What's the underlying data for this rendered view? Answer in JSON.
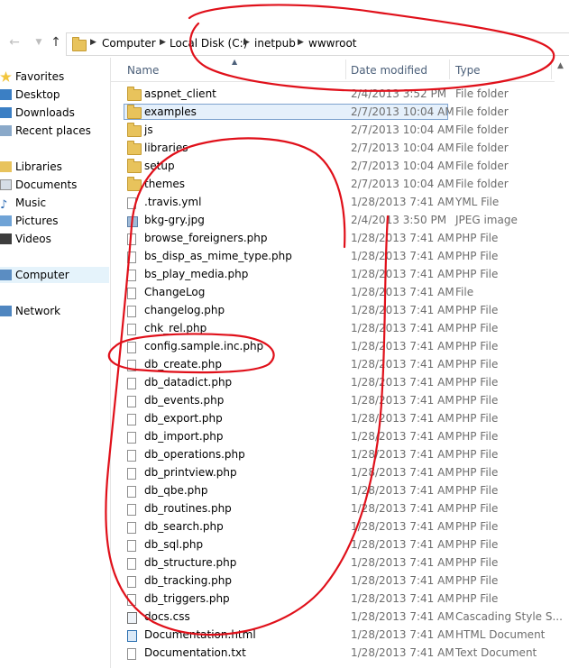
{
  "address_bar": {
    "segments": [
      "Computer",
      "Local Disk (C:)",
      "inetpub",
      "wwwroot"
    ]
  },
  "nav_pane": {
    "items": [
      {
        "label": "Favorites",
        "icon": "star-icon"
      },
      {
        "label": "Desktop",
        "icon": "desktop-icon"
      },
      {
        "label": "Downloads",
        "icon": "downloads-icon"
      },
      {
        "label": "Recent places",
        "icon": "recent-places-icon"
      },
      {
        "label": "Libraries",
        "icon": "libraries-icon"
      },
      {
        "label": "Documents",
        "icon": "documents-icon"
      },
      {
        "label": "Music",
        "icon": "music-icon"
      },
      {
        "label": "Pictures",
        "icon": "pictures-icon"
      },
      {
        "label": "Videos",
        "icon": "videos-icon"
      },
      {
        "label": "Computer",
        "icon": "computer-icon"
      },
      {
        "label": "Network",
        "icon": "network-icon"
      }
    ]
  },
  "columns": {
    "name": "Name",
    "date": "Date modified",
    "type": "Type"
  },
  "files": [
    {
      "name": "aspnet_client",
      "date": "2/4/2013 3:52 PM",
      "type": "File folder",
      "kind": "folder"
    },
    {
      "name": "examples",
      "date": "2/7/2013 10:04 AM",
      "type": "File folder",
      "kind": "folder"
    },
    {
      "name": "js",
      "date": "2/7/2013 10:04 AM",
      "type": "File folder",
      "kind": "folder"
    },
    {
      "name": "libraries",
      "date": "2/7/2013 10:04 AM",
      "type": "File folder",
      "kind": "folder"
    },
    {
      "name": "setup",
      "date": "2/7/2013 10:04 AM",
      "type": "File folder",
      "kind": "folder"
    },
    {
      "name": "themes",
      "date": "2/7/2013 10:04 AM",
      "type": "File folder",
      "kind": "folder"
    },
    {
      "name": ".travis.yml",
      "date": "1/28/2013 7:41 AM",
      "type": "YML File",
      "kind": "file"
    },
    {
      "name": "bkg-gry.jpg",
      "date": "2/4/2013 3:50 PM",
      "type": "JPEG image",
      "kind": "image"
    },
    {
      "name": "browse_foreigners.php",
      "date": "1/28/2013 7:41 AM",
      "type": "PHP File",
      "kind": "file"
    },
    {
      "name": "bs_disp_as_mime_type.php",
      "date": "1/28/2013 7:41 AM",
      "type": "PHP File",
      "kind": "file"
    },
    {
      "name": "bs_play_media.php",
      "date": "1/28/2013 7:41 AM",
      "type": "PHP File",
      "kind": "file"
    },
    {
      "name": "ChangeLog",
      "date": "1/28/2013 7:41 AM",
      "type": "File",
      "kind": "file"
    },
    {
      "name": "changelog.php",
      "date": "1/28/2013 7:41 AM",
      "type": "PHP File",
      "kind": "file"
    },
    {
      "name": "chk_rel.php",
      "date": "1/28/2013 7:41 AM",
      "type": "PHP File",
      "kind": "file"
    },
    {
      "name": "config.sample.inc.php",
      "date": "1/28/2013 7:41 AM",
      "type": "PHP File",
      "kind": "file"
    },
    {
      "name": "db_create.php",
      "date": "1/28/2013 7:41 AM",
      "type": "PHP File",
      "kind": "file"
    },
    {
      "name": "db_datadict.php",
      "date": "1/28/2013 7:41 AM",
      "type": "PHP File",
      "kind": "file"
    },
    {
      "name": "db_events.php",
      "date": "1/28/2013 7:41 AM",
      "type": "PHP File",
      "kind": "file"
    },
    {
      "name": "db_export.php",
      "date": "1/28/2013 7:41 AM",
      "type": "PHP File",
      "kind": "file"
    },
    {
      "name": "db_import.php",
      "date": "1/28/2013 7:41 AM",
      "type": "PHP File",
      "kind": "file"
    },
    {
      "name": "db_operations.php",
      "date": "1/28/2013 7:41 AM",
      "type": "PHP File",
      "kind": "file"
    },
    {
      "name": "db_printview.php",
      "date": "1/28/2013 7:41 AM",
      "type": "PHP File",
      "kind": "file"
    },
    {
      "name": "db_qbe.php",
      "date": "1/28/2013 7:41 AM",
      "type": "PHP File",
      "kind": "file"
    },
    {
      "name": "db_routines.php",
      "date": "1/28/2013 7:41 AM",
      "type": "PHP File",
      "kind": "file"
    },
    {
      "name": "db_search.php",
      "date": "1/28/2013 7:41 AM",
      "type": "PHP File",
      "kind": "file"
    },
    {
      "name": "db_sql.php",
      "date": "1/28/2013 7:41 AM",
      "type": "PHP File",
      "kind": "file"
    },
    {
      "name": "db_structure.php",
      "date": "1/28/2013 7:41 AM",
      "type": "PHP File",
      "kind": "file"
    },
    {
      "name": "db_tracking.php",
      "date": "1/28/2013 7:41 AM",
      "type": "PHP File",
      "kind": "file"
    },
    {
      "name": "db_triggers.php",
      "date": "1/28/2013 7:41 AM",
      "type": "PHP File",
      "kind": "file"
    },
    {
      "name": "docs.css",
      "date": "1/28/2013 7:41 AM",
      "type": "Cascading Style S...",
      "kind": "css"
    },
    {
      "name": "Documentation.html",
      "date": "1/28/2013 7:41 AM",
      "type": "HTML Document",
      "kind": "html"
    },
    {
      "name": "Documentation.txt",
      "date": "1/28/2013 7:41 AM",
      "type": "Text Document",
      "kind": "file"
    }
  ],
  "colors": {
    "annotation": "#e0101a",
    "header_text": "#4c607a",
    "folder": "#e8c35c",
    "hover_border": "#7da2ce"
  }
}
